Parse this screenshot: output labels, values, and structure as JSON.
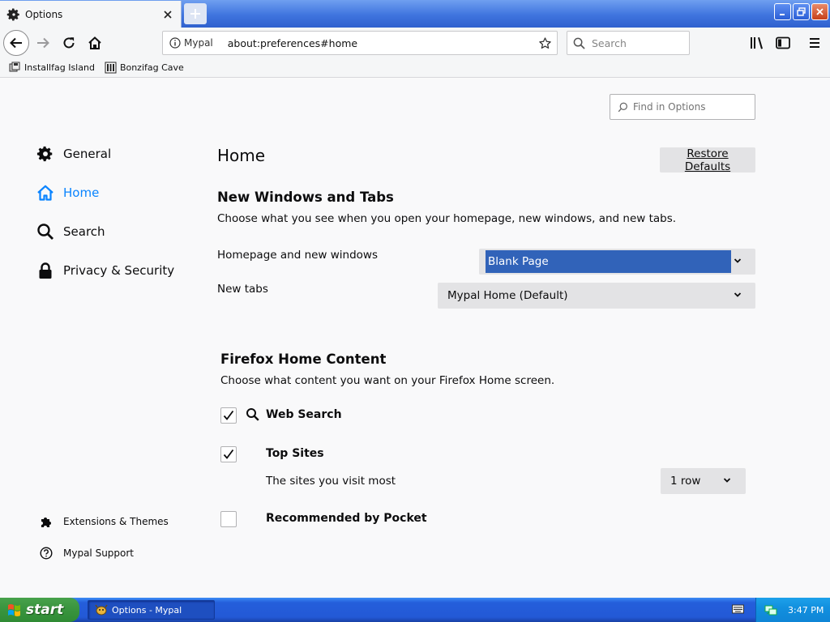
{
  "browser": {
    "tab_title": "Options",
    "identity_label": "Mypal",
    "url": "about:preferences#home",
    "search_placeholder": "Search"
  },
  "bookmarks": [
    {
      "label": "Installfag Island"
    },
    {
      "label": "Bonzifag Cave"
    }
  ],
  "sidebar": {
    "items": [
      {
        "label": "General",
        "icon": "gear-icon",
        "selected": false
      },
      {
        "label": "Home",
        "icon": "home-icon",
        "selected": true
      },
      {
        "label": "Search",
        "icon": "search-icon",
        "selected": false
      },
      {
        "label": "Privacy & Security",
        "icon": "lock-icon",
        "selected": false
      }
    ],
    "footer": [
      {
        "label": "Extensions & Themes",
        "icon": "puzzle-piece-icon"
      },
      {
        "label": "Mypal Support",
        "icon": "help-icon"
      }
    ]
  },
  "find_placeholder": "Find in Options",
  "page": {
    "title": "Home",
    "restore_label": "Restore Defaults",
    "section1": {
      "title": "New Windows and Tabs",
      "description": "Choose what you see when you open your homepage, new windows, and new tabs.",
      "homepage_label": "Homepage and new windows",
      "homepage_value": "Blank Page",
      "newtabs_label": "New tabs",
      "newtabs_value": "Mypal Home (Default)"
    },
    "section2": {
      "title": "Firefox Home Content",
      "description": "Choose what content you want on your Firefox Home screen.",
      "web_search": {
        "label": "Web Search",
        "checked": true
      },
      "top_sites": {
        "label": "Top Sites",
        "checked": true,
        "description": "The sites you visit most",
        "rows_value": "1 row"
      },
      "pocket": {
        "label": "Recommended by Pocket",
        "checked": false
      }
    }
  },
  "taskbar": {
    "start_label": "start",
    "task_label": "Options - Mypal",
    "clock": "3:47 PM"
  },
  "colors": {
    "accent": "#0a84ff",
    "select_highlight": "#3163b9",
    "taskbar_blue": "#245edb",
    "start_green": "#3b9640"
  }
}
